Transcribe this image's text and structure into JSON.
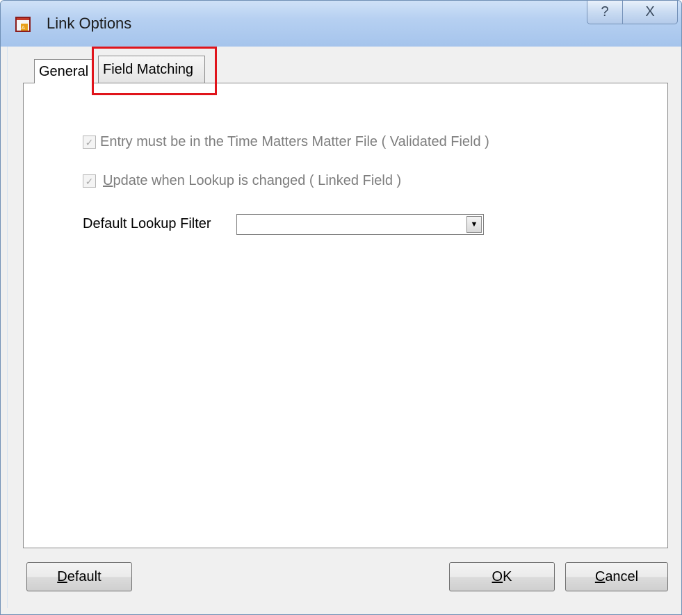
{
  "window": {
    "title": "Link Options",
    "help_glyph": "?",
    "close_glyph": "X"
  },
  "tabs": [
    {
      "label": "General",
      "selected": true
    },
    {
      "label": "Field Matching",
      "selected": false,
      "highlighted": true
    }
  ],
  "options": {
    "validated": {
      "label": "Entry must be in the Time Matters Matter File ( Validated Field )",
      "checked": true,
      "enabled": false
    },
    "linked": {
      "label_accel": "U",
      "label_rest": "pdate when Lookup is changed  ( Linked Field )",
      "checked": true,
      "enabled": false
    }
  },
  "filter": {
    "label": "Default Lookup Filter",
    "value": ""
  },
  "buttons": {
    "default_accel": "D",
    "default_rest": "efault",
    "ok_accel": "O",
    "ok_rest": "K",
    "cancel_accel": "C",
    "cancel_rest": "ancel"
  },
  "colors": {
    "highlight": "#e0141b",
    "titlebar": "#b6d0f1"
  }
}
